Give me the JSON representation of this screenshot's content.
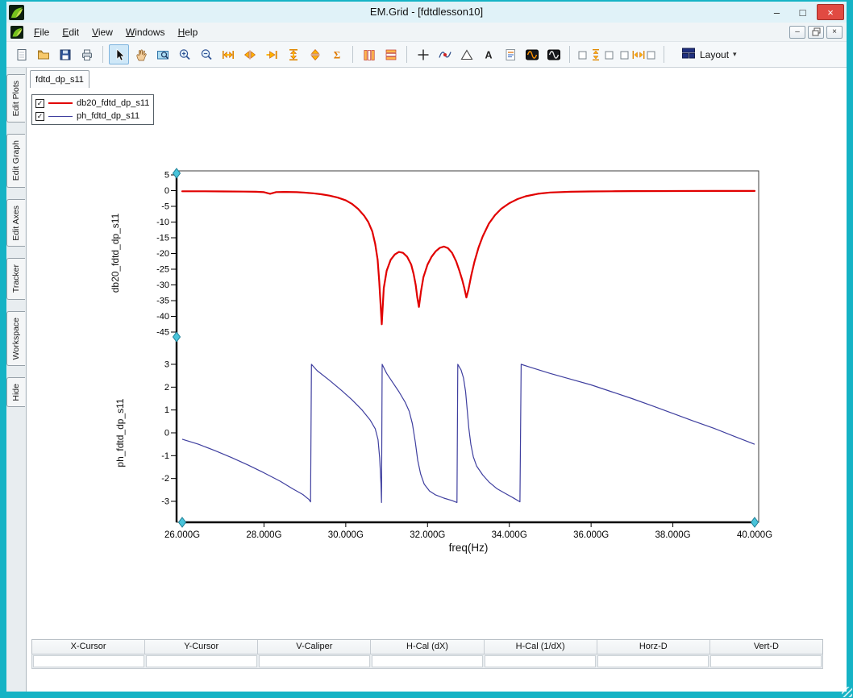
{
  "window": {
    "title": "EM.Grid - [fdtdlesson10]",
    "controls": {
      "minimize": "–",
      "maximize": "□",
      "close": "×"
    }
  },
  "menu_bar": {
    "items": [
      "File",
      "Edit",
      "View",
      "Windows",
      "Help"
    ]
  },
  "toolbar": {
    "layout_label": "Layout",
    "dropdown_caret": "▾",
    "items": [
      {
        "name": "new-document"
      },
      {
        "name": "open-folder"
      },
      {
        "name": "save"
      },
      {
        "name": "print"
      },
      {
        "sep": true
      },
      {
        "name": "select-arrow",
        "active": true
      },
      {
        "name": "pan-hand"
      },
      {
        "name": "zoom-region"
      },
      {
        "name": "zoom-in"
      },
      {
        "name": "zoom-out"
      },
      {
        "name": "h-expand"
      },
      {
        "name": "h-split"
      },
      {
        "name": "h-shift-right"
      },
      {
        "name": "v-expand"
      },
      {
        "name": "v-split"
      },
      {
        "name": "sum-sigma"
      },
      {
        "sep": true
      },
      {
        "name": "column-bars"
      },
      {
        "name": "row-bars"
      },
      {
        "sep": true
      },
      {
        "name": "add-cross"
      },
      {
        "name": "curve-marker"
      },
      {
        "name": "delta-marker"
      },
      {
        "name": "text-annotation"
      },
      {
        "name": "note-page"
      },
      {
        "name": "wave-orange"
      },
      {
        "name": "wave-white"
      },
      {
        "sep": true
      },
      {
        "name": "v-axis-toggle",
        "wide": true
      },
      {
        "name": "h-axis-toggle",
        "wide": true
      },
      {
        "sep": true
      },
      {
        "name": "layout-dropdown",
        "dropdown": true
      }
    ]
  },
  "sidebar": {
    "tabs": [
      "Edit Plots",
      "Edit Graph",
      "Edit Axes",
      "Tracker",
      "Workspace",
      "Hide"
    ]
  },
  "document_tab": {
    "label": "fdtd_dp_s11"
  },
  "legend": {
    "check_glyph": "✓",
    "series": [
      {
        "label": "db20_fdtd_dp_s11",
        "color": "#e10000",
        "line_width": 2,
        "checked": true
      },
      {
        "label": "ph_fdtd_dp_s11",
        "color": "#3f3f9f",
        "line_width": 1,
        "checked": true
      }
    ]
  },
  "chart_data": [
    {
      "type": "line",
      "ylabel": "db20_fdtd_dp_s11",
      "ylim": [
        -45,
        5
      ],
      "yticks": [
        5,
        0,
        -5,
        -10,
        -15,
        -20,
        -25,
        -30,
        -35,
        -40,
        -45
      ],
      "series": [
        {
          "name": "db20_fdtd_dp_s11",
          "color": "#e10000",
          "x_ghz": [
            26.0,
            26.5,
            27.0,
            27.5,
            27.8,
            28.0,
            28.15,
            28.3,
            28.5,
            28.8,
            29.0,
            29.2,
            29.4,
            29.6,
            29.8,
            30.0,
            30.15,
            30.3,
            30.45,
            30.55,
            30.65,
            30.72,
            30.78,
            30.82,
            30.85,
            30.88,
            30.93,
            31.0,
            31.1,
            31.2,
            31.3,
            31.4,
            31.5,
            31.6,
            31.66,
            31.71,
            31.75,
            31.79,
            31.84,
            31.9,
            32.0,
            32.1,
            32.2,
            32.3,
            32.4,
            32.5,
            32.6,
            32.7,
            32.78,
            32.85,
            32.9,
            32.95,
            33.0,
            33.07,
            33.15,
            33.25,
            33.35,
            33.5,
            33.65,
            33.8,
            34.0,
            34.2,
            34.4,
            34.7,
            35.0,
            35.5,
            36.0,
            36.5,
            37.0,
            38.0,
            39.0,
            40.0
          ],
          "y": [
            -0.2,
            -0.2,
            -0.25,
            -0.3,
            -0.35,
            -0.5,
            -1.0,
            -0.45,
            -0.4,
            -0.5,
            -0.65,
            -0.85,
            -1.15,
            -1.6,
            -2.2,
            -3.1,
            -4.2,
            -5.8,
            -8.0,
            -10.0,
            -13.0,
            -17.0,
            -22.0,
            -29.0,
            -36.0,
            -42.5,
            -31.0,
            -25.5,
            -22.0,
            -20.3,
            -19.5,
            -19.8,
            -21.0,
            -23.5,
            -26.5,
            -30.0,
            -34.0,
            -37.0,
            -32.0,
            -27.5,
            -23.5,
            -21.0,
            -19.3,
            -18.2,
            -17.8,
            -18.3,
            -19.8,
            -22.5,
            -25.5,
            -28.5,
            -31.0,
            -34.0,
            -31.5,
            -27.0,
            -22.5,
            -18.0,
            -14.5,
            -10.5,
            -7.8,
            -5.8,
            -4.0,
            -2.7,
            -1.8,
            -1.0,
            -0.6,
            -0.35,
            -0.25,
            -0.2,
            -0.15,
            -0.12,
            -0.1,
            -0.1
          ]
        }
      ]
    },
    {
      "type": "line",
      "ylabel": "ph_fdtd_dp_s11",
      "xlabel": "freq(Hz)",
      "ylim": [
        -3,
        3
      ],
      "yticks": [
        3,
        2,
        1,
        0,
        -1,
        -2,
        -3
      ],
      "xlim_ghz": [
        26,
        40
      ],
      "xticks_ghz": [
        26,
        28,
        30,
        32,
        34,
        36,
        38,
        40
      ],
      "xtick_labels": [
        "26.000G",
        "28.000G",
        "30.000G",
        "32.000G",
        "34.000G",
        "36.000G",
        "38.000G",
        "40.000G"
      ],
      "series": [
        {
          "name": "ph_fdtd_dp_s11",
          "color": "#3f3f9f",
          "x_ghz": [
            26.0,
            26.4,
            26.8,
            27.2,
            27.6,
            28.0,
            28.4,
            28.7,
            28.95,
            29.1,
            29.14,
            29.16,
            29.3,
            29.6,
            29.9,
            30.15,
            30.4,
            30.6,
            30.72,
            30.79,
            30.83,
            30.86,
            30.875,
            30.89,
            31.0,
            31.15,
            31.3,
            31.45,
            31.55,
            31.63,
            31.7,
            31.76,
            31.83,
            31.92,
            32.05,
            32.2,
            32.4,
            32.6,
            32.72,
            32.74,
            32.82,
            32.88,
            32.93,
            32.97,
            33.01,
            33.06,
            33.12,
            33.2,
            33.35,
            33.5,
            33.7,
            33.9,
            34.1,
            34.26,
            34.29,
            34.5,
            35.0,
            35.5,
            36.0,
            36.5,
            37.0,
            37.5,
            38.0,
            38.5,
            39.0,
            39.5,
            40.0
          ],
          "y": [
            -0.28,
            -0.5,
            -0.78,
            -1.08,
            -1.4,
            -1.75,
            -2.12,
            -2.45,
            -2.7,
            -2.92,
            -3.02,
            3.0,
            2.72,
            2.3,
            1.85,
            1.45,
            1.0,
            0.55,
            0.18,
            -0.3,
            -1.1,
            -2.2,
            -3.05,
            3.0,
            2.6,
            2.2,
            1.8,
            1.35,
            0.95,
            0.4,
            -0.4,
            -1.2,
            -1.8,
            -2.25,
            -2.55,
            -2.72,
            -2.86,
            -2.97,
            -3.05,
            3.0,
            2.75,
            2.4,
            1.8,
            1.0,
            0.2,
            -0.5,
            -1.05,
            -1.45,
            -1.85,
            -2.15,
            -2.45,
            -2.65,
            -2.85,
            -3.02,
            3.0,
            2.88,
            2.6,
            2.35,
            2.1,
            1.8,
            1.5,
            1.18,
            0.85,
            0.52,
            0.2,
            -0.15,
            -0.5
          ]
        }
      ]
    }
  ],
  "readout_table": {
    "columns": [
      "X-Cursor",
      "Y-Cursor",
      "V-Caliper",
      "H-Cal (dX)",
      "H-Cal (1/dX)",
      "Horz-D",
      "Vert-D"
    ],
    "values": [
      "",
      "",
      "",
      "",
      "",
      "",
      ""
    ]
  }
}
